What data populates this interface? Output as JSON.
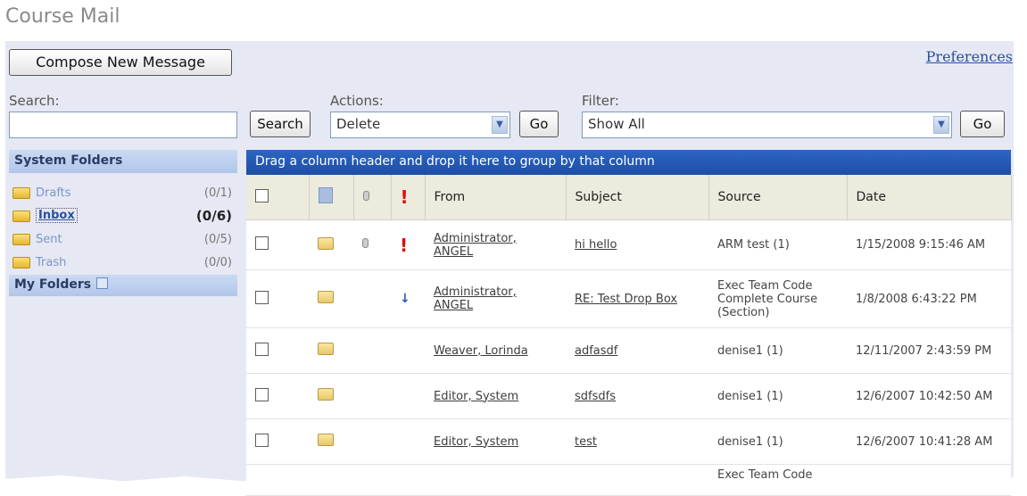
{
  "page": {
    "title": "Course Mail"
  },
  "toolbar": {
    "compose_label": "Compose New Message",
    "preferences_label": "Preferences"
  },
  "search": {
    "label": "Search:",
    "value": "",
    "button_label": "Search"
  },
  "actions": {
    "label": "Actions:",
    "selected": "Delete",
    "go_label": "Go"
  },
  "filter": {
    "label": "Filter:",
    "selected": "Show All",
    "go_label": "Go"
  },
  "sidebar": {
    "system_folders_label": "System Folders",
    "folders": [
      {
        "name": "Drafts",
        "count": "(0/1)"
      },
      {
        "name": "Inbox",
        "count": "(0/6)"
      },
      {
        "name": "Sent",
        "count": "(0/5)"
      },
      {
        "name": "Trash",
        "count": "(0/0)"
      }
    ],
    "my_folders_label": "My Folders"
  },
  "grid": {
    "group_hint": "Drag a column header and drop it here to group by that column",
    "columns": {
      "from": "From",
      "subject": "Subject",
      "source": "Source",
      "date": "Date"
    },
    "rows": [
      {
        "from": "Administrator, ANGEL",
        "subject": "hi hello",
        "source": "ARM test (1)",
        "date": "1/15/2008 9:15:46 AM",
        "attachment": true,
        "priority": "high"
      },
      {
        "from": "Administrator, ANGEL",
        "subject": "RE: Test Drop Box",
        "source": "Exec Team Code Complete Course (Section)",
        "date": "1/8/2008 6:43:22 PM",
        "attachment": false,
        "priority": "low"
      },
      {
        "from": "Weaver, Lorinda",
        "subject": "adfasdf",
        "source": "denise1 (1)",
        "date": "12/11/2007 2:43:59 PM",
        "attachment": false,
        "priority": "normal"
      },
      {
        "from": "Editor, System",
        "subject": "sdfsdfs",
        "source": "denise1 (1)",
        "date": "12/6/2007 10:42:50 AM",
        "attachment": false,
        "priority": "normal"
      },
      {
        "from": "Editor, System",
        "subject": "test",
        "source": "denise1 (1)",
        "date": "12/6/2007 10:41:28 AM",
        "attachment": false,
        "priority": "normal"
      },
      {
        "from": "",
        "subject": "",
        "source": "Exec Team Code",
        "date": "",
        "attachment": false,
        "priority": "normal"
      }
    ]
  }
}
